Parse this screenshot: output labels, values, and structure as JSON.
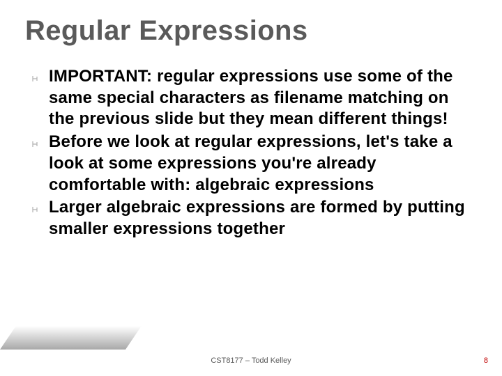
{
  "title": "Regular Expressions",
  "bullets": [
    "IMPORTANT: regular expressions use some of the same special characters as filename matching on the previous slide but they mean different things!",
    "Before we look at regular expressions, let's take a look at some expressions you're already comfortable with: algebraic expressions",
    "Larger algebraic expressions are formed by putting smaller expressions together"
  ],
  "footer": "CST8177 – Todd Kelley",
  "page_number": "8",
  "bullet_glyph": ""
}
